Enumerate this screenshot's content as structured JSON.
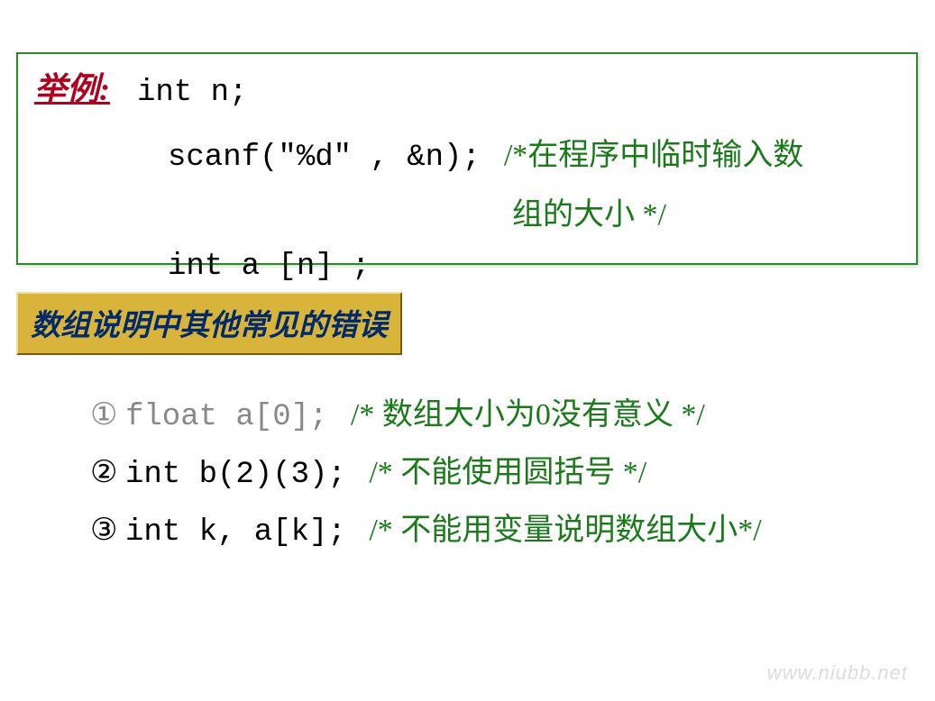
{
  "example": {
    "label": "举例:",
    "line1_code": "int n;",
    "line2_code": "scanf(\"%d\" , &n);",
    "line2_comment": "/*在程序中临时输入数",
    "line3_comment": "组的大小 */",
    "line4_code": "int a [n] ;"
  },
  "banner": {
    "text": "数组说明中其他常见的错误"
  },
  "errors": {
    "e1": {
      "marker": "①",
      "code": "float a[0];",
      "comment": "/* 数组大小为0没有意义 */"
    },
    "e2": {
      "marker": "②",
      "code": "int b(2)(3);",
      "comment": "/* 不能使用圆括号 */"
    },
    "e3": {
      "marker": "③",
      "code": "int k, a[k];",
      "comment": "/* 不能用变量说明数组大小*/"
    }
  },
  "watermark": "www.niubb.net"
}
